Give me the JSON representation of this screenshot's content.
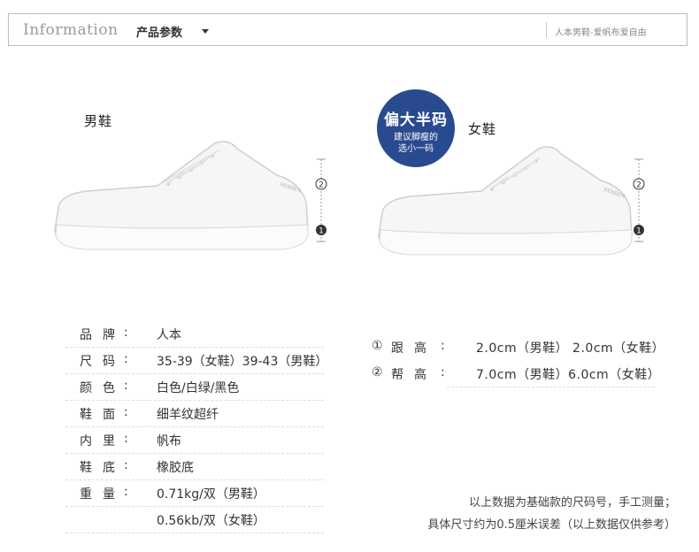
{
  "header": {
    "info_label": "Information",
    "params_label": "产品参数",
    "slogan": "人本男鞋-爱帆布爱自由"
  },
  "shoes": {
    "men_label": "男鞋",
    "women_label": "女鞋",
    "badge_title": "偏大半码",
    "badge_line1": "建议脚瘦的",
    "badge_line2": "选小一码",
    "brand_text": "RENBEN",
    "marker_1": "1",
    "marker_2": "2"
  },
  "specs": [
    {
      "key": "品牌",
      "value": "人本"
    },
    {
      "key": "尺码",
      "value": "35-39（女鞋）39-43（男鞋）"
    },
    {
      "key": "颜色",
      "value": "白色/白绿/黑色"
    },
    {
      "key": "鞋面",
      "value": "细羊纹超纤"
    },
    {
      "key": "内里",
      "value": "帆布"
    },
    {
      "key": "鞋底",
      "value": "橡胶底"
    },
    {
      "key": "重量",
      "value": "0.71kg/双（男鞋）"
    },
    {
      "key": "",
      "value": "0.56kb/双（女鞋）"
    }
  ],
  "heights": [
    {
      "num": "①",
      "key": "跟高",
      "value": "2.0cm（男鞋） 2.0cm（女鞋）"
    },
    {
      "num": "②",
      "key": "帮高",
      "value": "7.0cm（男鞋）6.0cm（女鞋）"
    }
  ],
  "note": {
    "line1": "以上数据为基础款的尺码号，手工测量；",
    "line2": "具体尺寸约为0.5厘米误差（以上数据仅供参考）"
  },
  "colors": {
    "badge": "#294a8e",
    "header_border": "#bdbdbd"
  }
}
